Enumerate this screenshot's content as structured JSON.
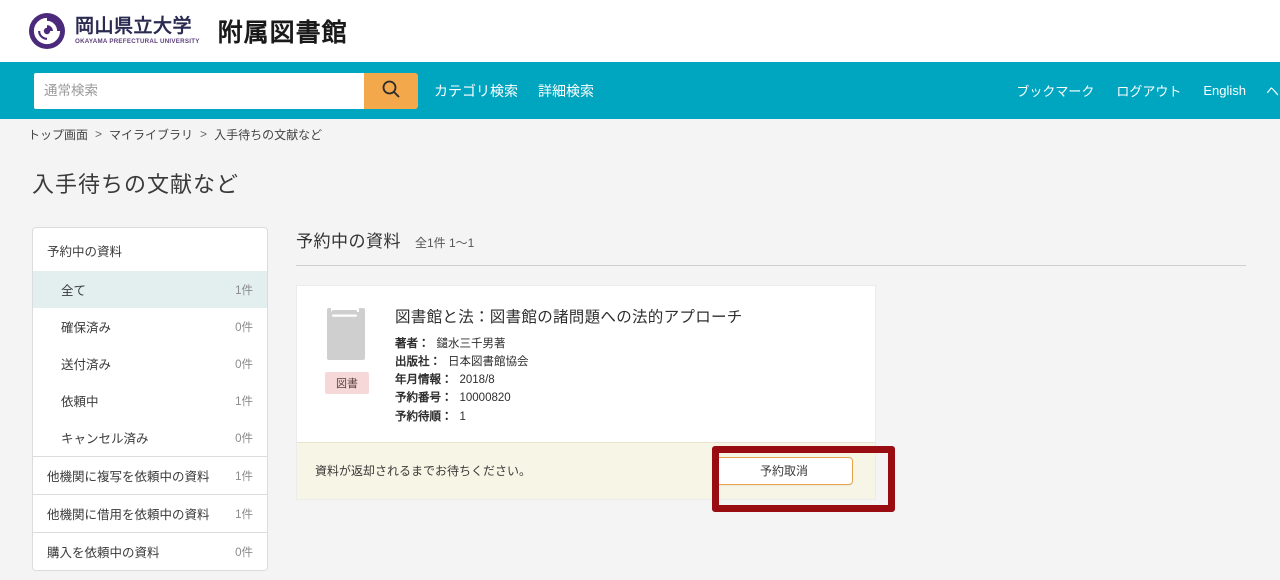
{
  "brand": {
    "logo_icon": "spiral-logo-icon",
    "name_jp": "岡山県立大学",
    "name_en": "OKAYAMA PREFECTURAL UNIVERSITY",
    "sub_title": "附属図書館",
    "logo_color": "#4b2a7b"
  },
  "nav": {
    "accent_color": "#00a5c0",
    "search": {
      "placeholder": "通常検索",
      "value": "",
      "button_icon": "search-icon",
      "button_color": "#f4a84c"
    },
    "links": [
      {
        "label": "カテゴリ検索"
      },
      {
        "label": "詳細検索"
      }
    ],
    "utility_links": [
      {
        "label": "ブックマーク"
      },
      {
        "label": "ログアウト"
      },
      {
        "label": "English"
      },
      {
        "label": "ヘルプ"
      }
    ]
  },
  "breadcrumb": {
    "items": [
      {
        "label": "トップ画面"
      },
      {
        "label": "マイライブラリ"
      },
      {
        "label": "入手待ちの文献など"
      }
    ],
    "separator": ">"
  },
  "page": {
    "title": "入手待ちの文献など"
  },
  "sidebar": {
    "group_title": "予約中の資料",
    "sub_items": [
      {
        "label": "全て",
        "count": "1件",
        "selected": true
      },
      {
        "label": "確保済み",
        "count": "0件",
        "selected": false
      },
      {
        "label": "送付済み",
        "count": "0件",
        "selected": false
      },
      {
        "label": "依頼中",
        "count": "1件",
        "selected": false
      },
      {
        "label": "キャンセル済み",
        "count": "0件",
        "selected": false
      }
    ],
    "top_items": [
      {
        "label": "他機関に複写を依頼中の資料",
        "count": "1件"
      },
      {
        "label": "他機関に借用を依頼中の資料",
        "count": "1件"
      },
      {
        "label": "購入を依頼中の資料",
        "count": "0件"
      }
    ],
    "selected_bg": "#e2efee"
  },
  "main": {
    "heading": "予約中の資料",
    "counts": "全1件 1〜1",
    "item": {
      "thumb_icon": "book-icon",
      "type_badge": "図書",
      "type_badge_color": "#f6d8d8",
      "title": "図書館と法：図書館の諸問題への法的アプローチ",
      "meta": [
        {
          "label": "著者：",
          "value": "鑓水三千男著"
        },
        {
          "label": "出版社：",
          "value": "日本図書館協会"
        },
        {
          "label": "年月情報：",
          "value": "2018/8"
        },
        {
          "label": "予約番号：",
          "value": "10000820"
        },
        {
          "label": "予約待順：",
          "value": "1"
        }
      ]
    },
    "footer": {
      "message": "資料が返却されるまでお待ちください。",
      "cancel_button": "予約取消",
      "bg_color": "#f7f5e6",
      "button_border_color": "#e8a44a"
    }
  },
  "annotation": {
    "highlight_color": "#990d12"
  }
}
